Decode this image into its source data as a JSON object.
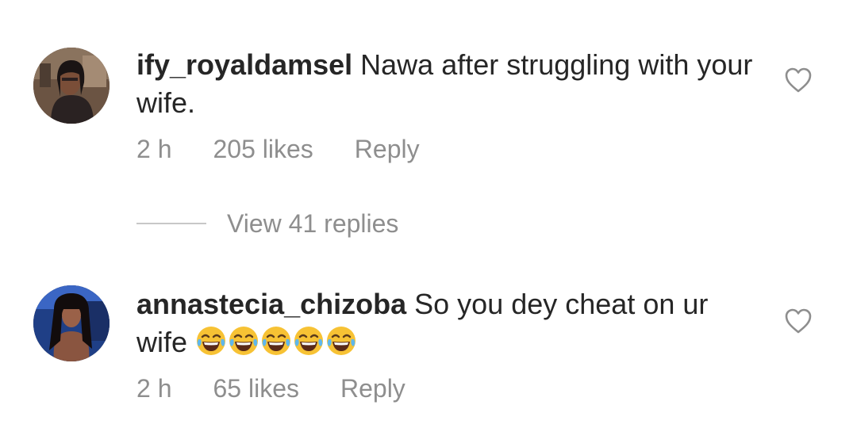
{
  "comments": [
    {
      "username": "ify_royaldamsel",
      "text": " Nawa after struggling with your wife.",
      "time": "2 h",
      "likes": "205 likes",
      "reply": "Reply",
      "view_replies": "View 41 replies",
      "avatar_icon": "profile-photo"
    },
    {
      "username": "annastecia_chizoba",
      "text": " So you dey cheat on ur wife ",
      "emojis": "😂😂😂😂😂",
      "time": "2 h",
      "likes": "65 likes",
      "reply": "Reply",
      "avatar_icon": "profile-photo"
    }
  ],
  "icons": {
    "like": "heart-outline-icon",
    "emoji": "face-with-tears-of-joy"
  },
  "colors": {
    "text": "#262626",
    "muted": "#8e8e8e",
    "divider": "#c7c7c7",
    "emoji_face": "#f7c234"
  }
}
